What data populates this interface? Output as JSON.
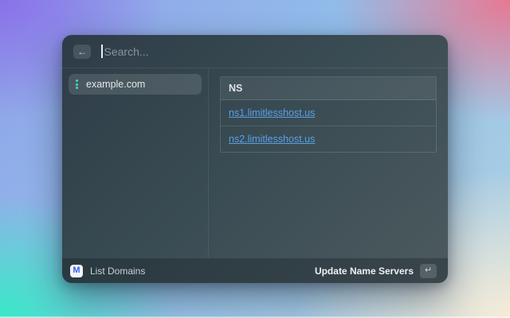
{
  "colors": {
    "link": "#58a0e6",
    "favicon_teal": "#3bd4c0",
    "logo_blue": "#3b5ef0"
  },
  "window": {
    "search": {
      "placeholder": "Search...",
      "value": ""
    },
    "back_icon": "←",
    "sidebar": {
      "items": [
        {
          "label": "example.com",
          "selected": true
        }
      ]
    },
    "content": {
      "table": {
        "header": "NS",
        "rows": [
          "ns1.limitlesshost.us",
          "ns2.limitlesshost.us"
        ]
      }
    },
    "footer": {
      "app_icon_letter": "M",
      "command_label": "List Domains",
      "action_label": "Update Name Servers",
      "enter_key": "↵"
    }
  }
}
